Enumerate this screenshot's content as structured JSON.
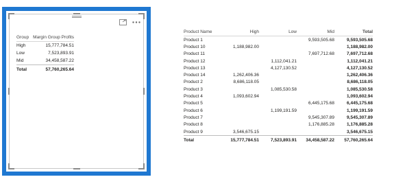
{
  "left_visual": {
    "icons": [
      "focus-mode-icon",
      "more-options-icon"
    ],
    "headers": {
      "group": "Group",
      "profits": "Margin Group Profits"
    },
    "rows": [
      {
        "group": "High",
        "value": "15,777,784.51"
      },
      {
        "group": "Low",
        "value": "7,523,893.91"
      },
      {
        "group": "Mid",
        "value": "34,458,587.22"
      }
    ],
    "total": {
      "label": "Total",
      "value": "57,760,265.64"
    }
  },
  "right_table": {
    "headers": {
      "name": "Product Name",
      "high": "High",
      "low": "Low",
      "mid": "Mid",
      "total": "Total"
    },
    "rows": [
      {
        "name": "Product 1",
        "high": "",
        "low": "",
        "mid": "9,593,505.68",
        "total": "9,593,505.68"
      },
      {
        "name": "Product 10",
        "high": "1,188,982.00",
        "low": "",
        "mid": "",
        "total": "1,188,982.00"
      },
      {
        "name": "Product 11",
        "high": "",
        "low": "",
        "mid": "7,697,712.68",
        "total": "7,697,712.68"
      },
      {
        "name": "Product 12",
        "high": "",
        "low": "1,112,041.21",
        "mid": "",
        "total": "1,112,041.21"
      },
      {
        "name": "Product 13",
        "high": "",
        "low": "4,127,130.52",
        "mid": "",
        "total": "4,127,130.52"
      },
      {
        "name": "Product 14",
        "high": "1,262,406.36",
        "low": "",
        "mid": "",
        "total": "1,262,406.36"
      },
      {
        "name": "Product 2",
        "high": "8,686,118.05",
        "low": "",
        "mid": "",
        "total": "8,686,118.05"
      },
      {
        "name": "Product 3",
        "high": "",
        "low": "1,085,530.58",
        "mid": "",
        "total": "1,085,530.58"
      },
      {
        "name": "Product 4",
        "high": "1,093,602.94",
        "low": "",
        "mid": "",
        "total": "1,093,602.94"
      },
      {
        "name": "Product 5",
        "high": "",
        "low": "",
        "mid": "6,445,175.68",
        "total": "6,445,175.68"
      },
      {
        "name": "Product 6",
        "high": "",
        "low": "1,199,191.59",
        "mid": "",
        "total": "1,199,191.59"
      },
      {
        "name": "Product 7",
        "high": "",
        "low": "",
        "mid": "9,545,307.89",
        "total": "9,545,307.89"
      },
      {
        "name": "Product 8",
        "high": "",
        "low": "",
        "mid": "1,176,885.28",
        "total": "1,176,885.28"
      },
      {
        "name": "Product 9",
        "high": "3,546,675.15",
        "low": "",
        "mid": "",
        "total": "3,546,675.15"
      }
    ],
    "total": {
      "name": "Total",
      "high": "15,777,784.51",
      "low": "7,523,893.91",
      "mid": "34,458,587.22",
      "total": "57,760,265.64"
    }
  },
  "colors": {
    "selection_border": "#1f78d1"
  }
}
